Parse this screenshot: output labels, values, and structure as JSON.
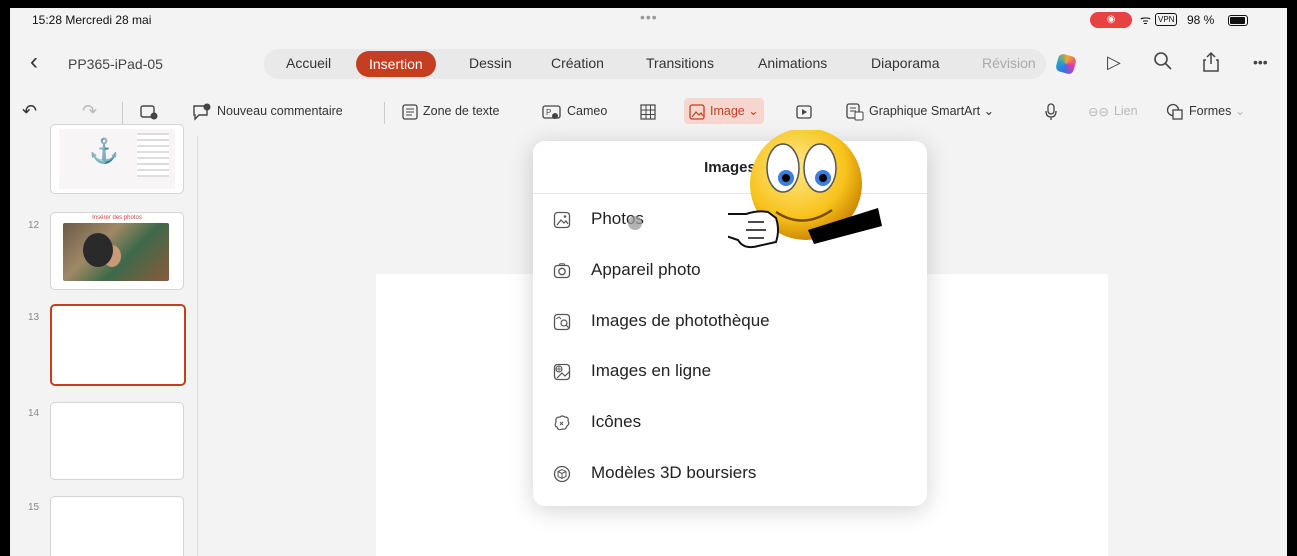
{
  "status": {
    "time_date": "15:28  Mercredi 28 mai",
    "vpn": "VPN",
    "battery": "98 %",
    "colors": {
      "record": "#e84141"
    }
  },
  "app": {
    "doc_name": "PP365-iPad-05",
    "accent_color": "#c63e22",
    "tabs": [
      "Accueil",
      "Insertion",
      "Dessin",
      "Création",
      "Transitions",
      "Animations",
      "Diaporama",
      "Révision"
    ],
    "active_tab": "Insertion"
  },
  "toolbar": {
    "new_comment": "Nouveau commentaire",
    "text_box": "Zone de texte",
    "cameo": "Cameo",
    "image": "Image",
    "smartart": "Graphique SmartArt",
    "link": "Lien",
    "shapes": "Formes"
  },
  "slides": {
    "numbers": [
      "12",
      "13",
      "14",
      "15"
    ],
    "thumb12_title": "Insérer des photos",
    "selected": "13"
  },
  "image_menu": {
    "title": "Images",
    "items": [
      "Photos",
      "Appareil photo",
      "Images de photothèque",
      "Images en ligne",
      "Icônes",
      "Modèles 3D boursiers"
    ]
  }
}
